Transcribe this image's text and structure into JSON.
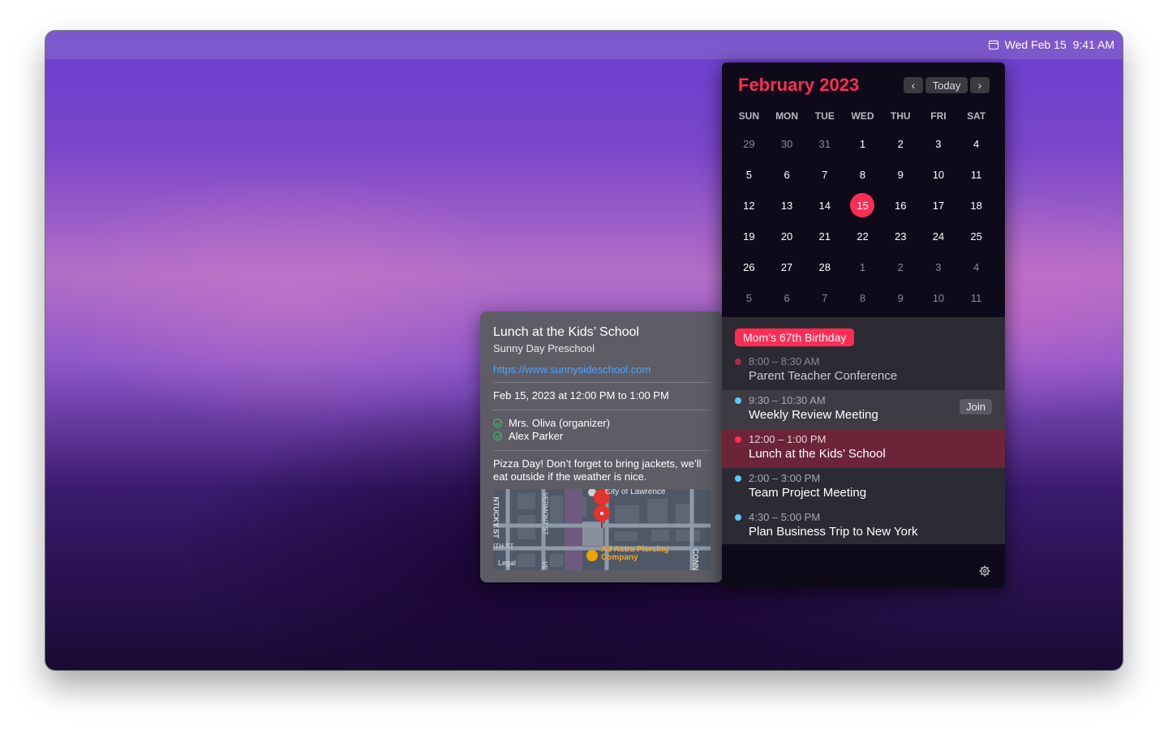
{
  "menubar": {
    "date": "Wed Feb 15",
    "time": "9:41 AM",
    "icon": "calendar-icon"
  },
  "calendar": {
    "month_title": "February 2023",
    "today_label": "Today",
    "weekdays": [
      "SUN",
      "MON",
      "TUE",
      "WED",
      "THU",
      "FRI",
      "SAT"
    ],
    "days": [
      [
        "29",
        "30",
        "31",
        "1",
        "2",
        "3",
        "4"
      ],
      [
        "5",
        "6",
        "7",
        "8",
        "9",
        "10",
        "11"
      ],
      [
        "12",
        "13",
        "14",
        "15",
        "16",
        "17",
        "18"
      ],
      [
        "19",
        "20",
        "21",
        "22",
        "23",
        "24",
        "25"
      ],
      [
        "26",
        "27",
        "28",
        "1",
        "2",
        "3",
        "4"
      ],
      [
        "5",
        "6",
        "7",
        "8",
        "9",
        "10",
        "11"
      ]
    ],
    "accent_color": "#ff2d55"
  },
  "events": {
    "allday": "Mom’s 67th Birthday",
    "list": [
      {
        "time": "8:00 – 8:30 AM",
        "title": "Parent Teacher Conference",
        "color": "#ff2d55"
      },
      {
        "time": "9:30 – 10:30 AM",
        "title": "Weekly Review Meeting",
        "color": "#5ac8fa",
        "action": "Join"
      },
      {
        "time": "12:00 – 1:00 PM",
        "title": "Lunch at the Kids’ School",
        "color": "#ff2d55"
      },
      {
        "time": "2:00 – 3:00 PM",
        "title": "Team Project Meeting",
        "color": "#5ac8fa"
      },
      {
        "time": "4:30 – 5:00 PM",
        "title": "Plan Business Trip to New York",
        "color": "#5ac8fa"
      }
    ]
  },
  "popover": {
    "title": "Lunch at the Kids’ School",
    "location": "Sunny Day Preschool",
    "url": "https://www.sunnysideschool.com",
    "datetime": "Feb 15, 2023 at 12:00 PM to 1:00 PM",
    "attendees": [
      "Mrs. Oliva (organizer)",
      "Alex Parker"
    ],
    "note": "Pizza Day! Don’t forget to bring jackets, we’ll eat outside if the weather is nice.",
    "map": {
      "poi_top": "City of Lawrence",
      "poi_business": "Ad Astra Piercing Company",
      "street_left": "NTUCKY ST",
      "street_vermont": "VERMONT ST",
      "street_9th": "ITH ST",
      "street_right": "CONN",
      "street_bottom": "VE",
      "legal": "Legal"
    }
  }
}
